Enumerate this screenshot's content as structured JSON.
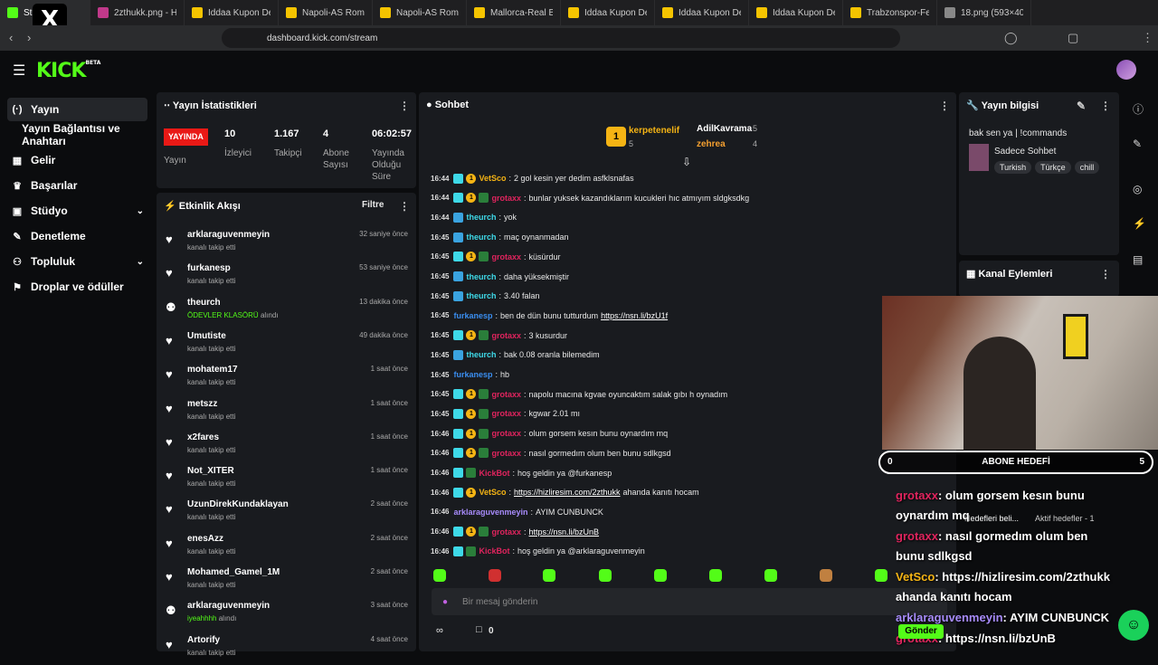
{
  "browser": {
    "tabs": [
      {
        "label": "Stre",
        "color": "#53fc18"
      },
      {
        "label": "2zthukk.png - Hızlı",
        "color": "#c0398a"
      },
      {
        "label": "İddaa Kupon Detay",
        "color": "#f5c400"
      },
      {
        "label": "Napoli-AS Roma | ",
        "color": "#f5c400"
      },
      {
        "label": "Napoli-AS Roma | ",
        "color": "#f5c400"
      },
      {
        "label": "Mallorca-Real Betis",
        "color": "#f5c400"
      },
      {
        "label": "İddaa Kupon Detay",
        "color": "#f5c400"
      },
      {
        "label": "İddaa Kupon Detay",
        "color": "#f5c400"
      },
      {
        "label": "İddaa Kupon Detay",
        "color": "#f5c400"
      },
      {
        "label": "Trabzonspor-Fenerb",
        "color": "#f5c400"
      },
      {
        "label": "18.png (593×400)",
        "color": "#888888"
      }
    ],
    "url": "dashboard.kick.com/stream"
  },
  "brand": {
    "logo": "KICK",
    "beta": "BETA"
  },
  "sidebar": {
    "items": [
      {
        "label": "Yayın",
        "icon": "broadcast-icon",
        "active": true
      },
      {
        "label": "Yayın Bağlantısı ve Anahtarı",
        "icon": "",
        "active": false
      },
      {
        "label": "Gelir",
        "icon": "chart-icon"
      },
      {
        "label": "Başarılar",
        "icon": "trophy-icon"
      },
      {
        "label": "Stüdyo",
        "icon": "studio-icon",
        "chevron": true
      },
      {
        "label": "Denetleme",
        "icon": "wrench-icon"
      },
      {
        "label": "Topluluk",
        "icon": "people-icon",
        "chevron": true
      },
      {
        "label": "Droplar ve ödüller",
        "icon": "gift-icon"
      }
    ]
  },
  "stats": {
    "title": "Yayın İstatistikleri",
    "live": "YAYINDA",
    "live_label": "Yayın",
    "viewers": "10",
    "viewers_label": "İzleyici",
    "followers": "1.167",
    "followers_label": "Takipçi",
    "subs": "4",
    "subs_label": "Abone Sayısı",
    "uptime": "06:02:57",
    "uptime_label": "Yayında Olduğu Süre"
  },
  "activity": {
    "title": "Etkinlik Akışı",
    "filter": "Filtre",
    "events": [
      {
        "name": "arklaraguvenmeyin",
        "sub": "kanalı takip etti",
        "time": "32 saniye önce",
        "type": "follow"
      },
      {
        "name": "furkanesp",
        "sub": "kanalı takip etti",
        "time": "53 saniye önce",
        "type": "follow"
      },
      {
        "name": "theurch",
        "sub_green": "ÖDEVLER KLASÖRÜ",
        "sub": "alındı",
        "time": "13 dakika önce",
        "type": "reward"
      },
      {
        "name": "Umutiste",
        "sub": "kanalı takip etti",
        "time": "49 dakika önce",
        "type": "follow"
      },
      {
        "name": "mohatem17",
        "sub": "kanalı takip etti",
        "time": "1 saat önce",
        "type": "follow"
      },
      {
        "name": "metszz",
        "sub": "kanalı takip etti",
        "time": "1 saat önce",
        "type": "follow"
      },
      {
        "name": "x2fares",
        "sub": "kanalı takip etti",
        "time": "1 saat önce",
        "type": "follow"
      },
      {
        "name": "Not_XITER",
        "sub": "kanalı takip etti",
        "time": "1 saat önce",
        "type": "follow"
      },
      {
        "name": "UzunDirekKundaklayan",
        "sub": "kanalı takip etti",
        "time": "2 saat önce",
        "type": "follow"
      },
      {
        "name": "enesAzz",
        "sub": "kanalı takip etti",
        "time": "2 saat önce",
        "type": "follow"
      },
      {
        "name": "Mohamed_Gamel_1M",
        "sub": "kanalı takip etti",
        "time": "2 saat önce",
        "type": "follow"
      },
      {
        "name": "arklaraguvenmeyin",
        "sub_green": "iyeahhhh",
        "sub": "alındı",
        "time": "3 saat önce",
        "type": "reward"
      },
      {
        "name": "Artorify",
        "sub": "kanalı takip etti",
        "time": "4 saat önce",
        "type": "follow"
      }
    ]
  },
  "chat": {
    "title": "Sohbet",
    "leaders": [
      {
        "name": "kerpetenelif",
        "count": "5",
        "rank": "1"
      },
      {
        "name": "AdilKavrama",
        "count": "5"
      },
      {
        "name": "zehrea",
        "count": "4"
      }
    ],
    "messages": [
      {
        "t": "16:44",
        "user": "VetSco",
        "color": "#f5b414",
        "text": "2 gol kesin yer dedim asfklsnafas",
        "badges": [
          "b2",
          "b1"
        ]
      },
      {
        "t": "16:44",
        "user": "grotaxx",
        "color": "#e0245e",
        "text": "bunlar yuksek kazandıklarım kucukleri hıc atmıyım sldgksdkg",
        "badges": [
          "b2",
          "b1",
          "b3"
        ]
      },
      {
        "t": "16:44",
        "user": "theurch",
        "color": "#3ed9e8",
        "text": "yok",
        "badges": [
          "b4"
        ]
      },
      {
        "t": "16:45",
        "user": "theurch",
        "color": "#3ed9e8",
        "text": "maç oynanmadan",
        "badges": [
          "b4"
        ]
      },
      {
        "t": "16:45",
        "user": "grotaxx",
        "color": "#e0245e",
        "text": "küsürdur",
        "badges": [
          "b2",
          "b1",
          "b3"
        ]
      },
      {
        "t": "16:45",
        "user": "theurch",
        "color": "#3ed9e8",
        "text": "daha yüksekmiştir",
        "badges": [
          "b4"
        ]
      },
      {
        "t": "16:45",
        "user": "theurch",
        "color": "#3ed9e8",
        "text": "3.40 falan",
        "badges": [
          "b4"
        ]
      },
      {
        "t": "16:45",
        "user": "furkanesp",
        "color": "#3a8ef0",
        "text": "ben de dün bunu tutturdum",
        "link": "https://nsn.li/bzU1f",
        "badges": []
      },
      {
        "t": "16:45",
        "user": "grotaxx",
        "color": "#e0245e",
        "text": "3 kusurdur",
        "badges": [
          "b2",
          "b1",
          "b3"
        ]
      },
      {
        "t": "16:45",
        "user": "theurch",
        "color": "#3ed9e8",
        "text": "bak 0.08 oranla bilemedim",
        "badges": [
          "b4"
        ]
      },
      {
        "t": "16:45",
        "user": "furkanesp",
        "color": "#3a8ef0",
        "text": "hb",
        "badges": []
      },
      {
        "t": "16:45",
        "user": "grotaxx",
        "color": "#e0245e",
        "text": "napolu macına kgvae oyuncaktım salak gıbı h oynadım",
        "badges": [
          "b2",
          "b1",
          "b3"
        ]
      },
      {
        "t": "16:45",
        "user": "grotaxx",
        "color": "#e0245e",
        "text": "kgwar 2.01 mı",
        "badges": [
          "b2",
          "b1",
          "b3"
        ]
      },
      {
        "t": "16:46",
        "user": "grotaxx",
        "color": "#e0245e",
        "text": "olum gorsem kesın bunu oynardım mq",
        "badges": [
          "b2",
          "b1",
          "b3"
        ]
      },
      {
        "t": "16:46",
        "user": "grotaxx",
        "color": "#e0245e",
        "text": "nasıl gormedım olum ben bunu sdlkgsd",
        "badges": [
          "b2",
          "b1",
          "b3"
        ]
      },
      {
        "t": "16:46",
        "user": "KickBot",
        "color": "#e0245e",
        "text": "hoş geldin ya @furkanesp",
        "badges": [
          "b2",
          "b3"
        ]
      },
      {
        "t": "16:46",
        "user": "VetSco",
        "color": "#f5b414",
        "text": "",
        "link": "https://hizliresim.com/2zthukk",
        "after": "ahanda kanıtı hocam",
        "badges": [
          "b2",
          "b1"
        ]
      },
      {
        "t": "16:46",
        "user": "arklaraguvenmeyin",
        "color": "#a78bfa",
        "text": "AYIM CUNBUNCK",
        "badges": []
      },
      {
        "t": "16:46",
        "user": "grotaxx",
        "color": "#e0245e",
        "text": "",
        "link": "https://nsn.li/bzUnB",
        "badges": [
          "b2",
          "b1",
          "b3"
        ]
      },
      {
        "t": "16:46",
        "user": "KickBot",
        "color": "#e0245e",
        "text": "hoş geldin ya @arklaraguvenmeyin",
        "badges": [
          "b2",
          "b3"
        ]
      }
    ],
    "input_placeholder": "Bir mesaj gönderin",
    "send": "Gönder",
    "viewers_count": "0"
  },
  "info": {
    "title": "Yayın bilgisi",
    "stream_title": "bak sen ya | !commands",
    "category": "Sadece Sohbet",
    "tags": [
      "Turkish",
      "Türkçe",
      "chill"
    ]
  },
  "actions": {
    "title": "Kanal Eylemleri"
  },
  "overlay": {
    "goal": "ABONE HEDEFİ",
    "goal_left": "0",
    "goal_right": "5",
    "lines": [
      {
        "user": "grotaxx",
        "text": ": olum gorsem kesın bunu"
      },
      {
        "user": "",
        "text": "oynardım mq"
      },
      {
        "user": "grotaxx",
        "text": ": nasıl gormedım olum ben"
      },
      {
        "user": "",
        "text": "bunu sdlkgsd"
      },
      {
        "user": "VetSco",
        "text": ": https://hizliresim.com/2zthukk"
      },
      {
        "user": "",
        "text": "ahanda kanıtı hocam"
      },
      {
        "user": "arklaraguvenmeyin",
        "text": ": AYIM CUNBUNCK"
      },
      {
        "user": "grotaxx",
        "text": ": https://nsn.li/bzUnB"
      }
    ],
    "goals_label": "Hedefleri beli...",
    "active_goals": "Aktif hedefler - 1"
  }
}
